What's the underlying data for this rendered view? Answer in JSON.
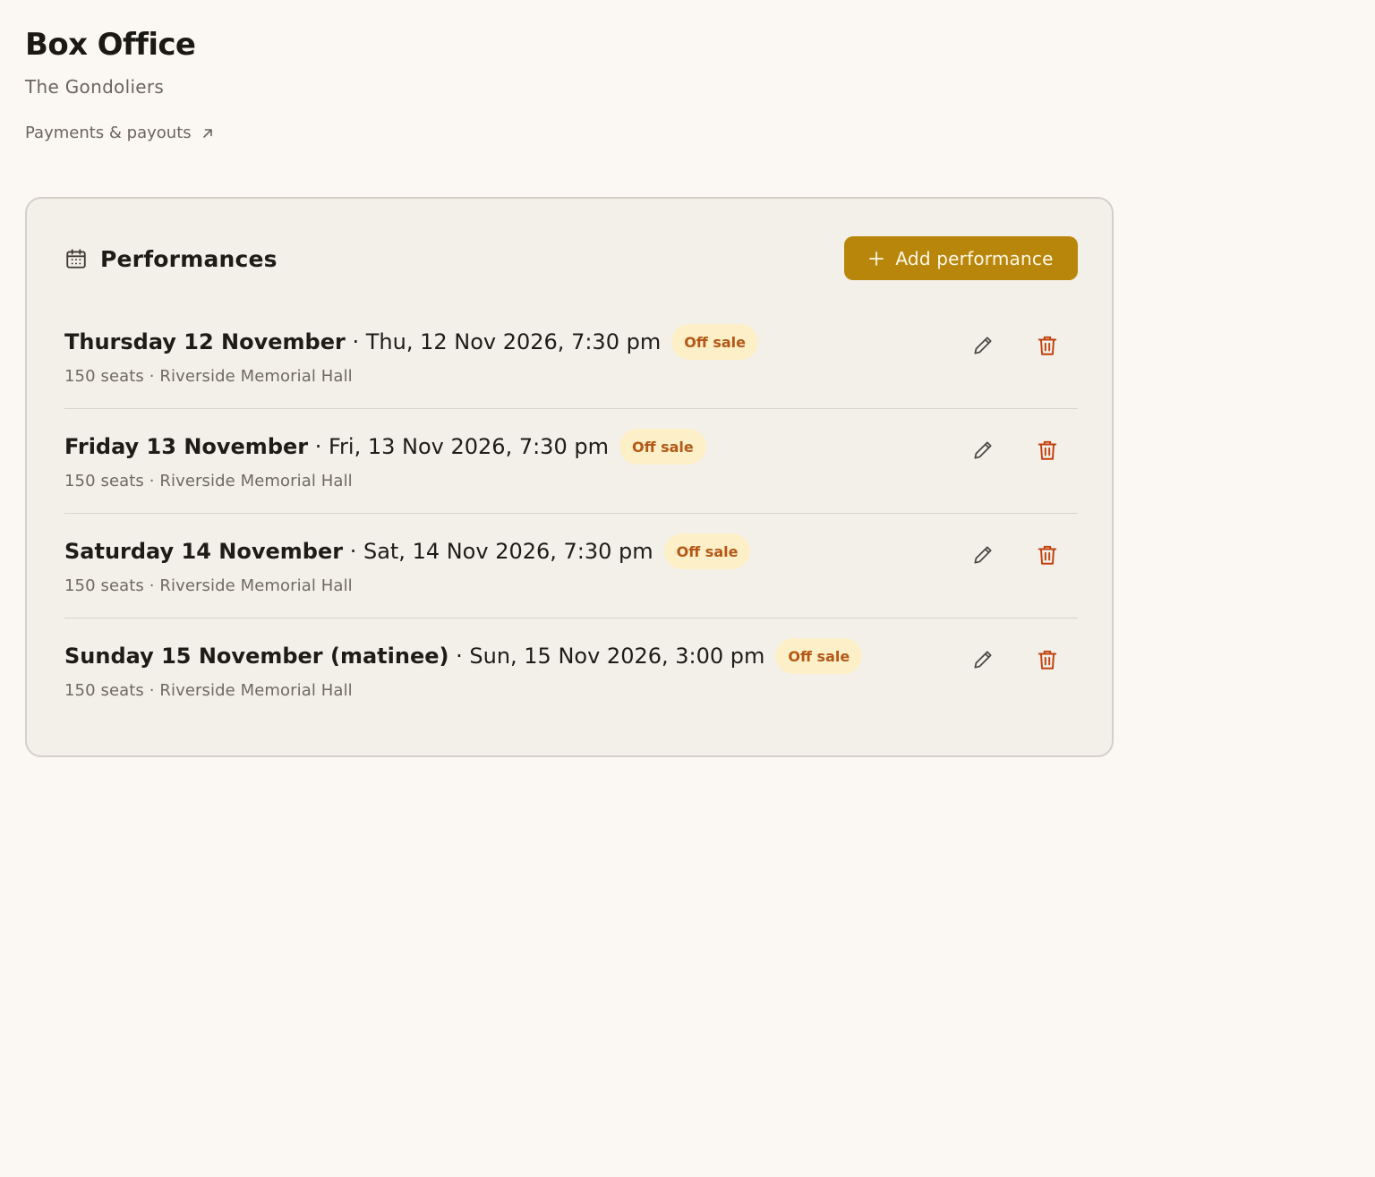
{
  "app": {
    "title": "Box Office",
    "subtitle": "The Gondoliers",
    "payments_link_label": "Payments & payouts",
    "payments_link_icon": "arrow-up-right-icon"
  },
  "card": {
    "title": "Performances",
    "title_icon": "calendar-icon",
    "add_button_label": "Add performance",
    "add_button_icon": "plus-icon",
    "accent_color": "#b8860b"
  },
  "performances": [
    {
      "name": "Thursday 12 November",
      "separator": " · ",
      "datetime": "Thu, 12 Nov 2026, 7:30 pm",
      "status": "Off sale",
      "meta": "150 seats · Riverside Memorial Hall",
      "edit_icon": "pencil-icon",
      "delete_icon": "trash-icon"
    },
    {
      "name": "Friday 13 November",
      "separator": " · ",
      "datetime": "Fri, 13 Nov 2026, 7:30 pm",
      "status": "Off sale",
      "meta": "150 seats · Riverside Memorial Hall",
      "edit_icon": "pencil-icon",
      "delete_icon": "trash-icon"
    },
    {
      "name": "Saturday 14 November",
      "separator": " · ",
      "datetime": "Sat, 14 Nov 2026, 7:30 pm",
      "status": "Off sale",
      "meta": "150 seats · Riverside Memorial Hall",
      "edit_icon": "pencil-icon",
      "delete_icon": "trash-icon"
    },
    {
      "name": "Sunday 15 November (matinee)",
      "separator": " · ",
      "datetime": "Sun, 15 Nov 2026, 3:00 pm",
      "status": "Off sale",
      "meta": "150 seats · Riverside Memorial Hall",
      "edit_icon": "pencil-icon",
      "delete_icon": "trash-icon"
    }
  ],
  "colors": {
    "background": "#fbf8f4",
    "card_background": "#f3f0ea",
    "badge_background": "#fdefc7",
    "badge_text": "#b35918",
    "delete_icon": "#c2410c"
  }
}
